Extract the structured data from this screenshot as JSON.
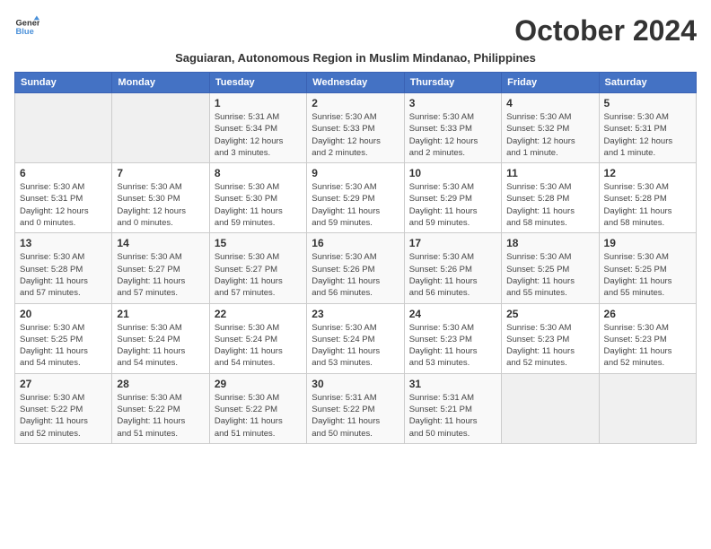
{
  "logo": {
    "line1": "General",
    "line2": "Blue"
  },
  "title": "October 2024",
  "subtitle": "Saguiaran, Autonomous Region in Muslim Mindanao, Philippines",
  "days_header": [
    "Sunday",
    "Monday",
    "Tuesday",
    "Wednesday",
    "Thursday",
    "Friday",
    "Saturday"
  ],
  "weeks": [
    [
      {
        "day": "",
        "info": ""
      },
      {
        "day": "",
        "info": ""
      },
      {
        "day": "1",
        "info": "Sunrise: 5:31 AM\nSunset: 5:34 PM\nDaylight: 12 hours\nand 3 minutes."
      },
      {
        "day": "2",
        "info": "Sunrise: 5:30 AM\nSunset: 5:33 PM\nDaylight: 12 hours\nand 2 minutes."
      },
      {
        "day": "3",
        "info": "Sunrise: 5:30 AM\nSunset: 5:33 PM\nDaylight: 12 hours\nand 2 minutes."
      },
      {
        "day": "4",
        "info": "Sunrise: 5:30 AM\nSunset: 5:32 PM\nDaylight: 12 hours\nand 1 minute."
      },
      {
        "day": "5",
        "info": "Sunrise: 5:30 AM\nSunset: 5:31 PM\nDaylight: 12 hours\nand 1 minute."
      }
    ],
    [
      {
        "day": "6",
        "info": "Sunrise: 5:30 AM\nSunset: 5:31 PM\nDaylight: 12 hours\nand 0 minutes."
      },
      {
        "day": "7",
        "info": "Sunrise: 5:30 AM\nSunset: 5:30 PM\nDaylight: 12 hours\nand 0 minutes."
      },
      {
        "day": "8",
        "info": "Sunrise: 5:30 AM\nSunset: 5:30 PM\nDaylight: 11 hours\nand 59 minutes."
      },
      {
        "day": "9",
        "info": "Sunrise: 5:30 AM\nSunset: 5:29 PM\nDaylight: 11 hours\nand 59 minutes."
      },
      {
        "day": "10",
        "info": "Sunrise: 5:30 AM\nSunset: 5:29 PM\nDaylight: 11 hours\nand 59 minutes."
      },
      {
        "day": "11",
        "info": "Sunrise: 5:30 AM\nSunset: 5:28 PM\nDaylight: 11 hours\nand 58 minutes."
      },
      {
        "day": "12",
        "info": "Sunrise: 5:30 AM\nSunset: 5:28 PM\nDaylight: 11 hours\nand 58 minutes."
      }
    ],
    [
      {
        "day": "13",
        "info": "Sunrise: 5:30 AM\nSunset: 5:28 PM\nDaylight: 11 hours\nand 57 minutes."
      },
      {
        "day": "14",
        "info": "Sunrise: 5:30 AM\nSunset: 5:27 PM\nDaylight: 11 hours\nand 57 minutes."
      },
      {
        "day": "15",
        "info": "Sunrise: 5:30 AM\nSunset: 5:27 PM\nDaylight: 11 hours\nand 57 minutes."
      },
      {
        "day": "16",
        "info": "Sunrise: 5:30 AM\nSunset: 5:26 PM\nDaylight: 11 hours\nand 56 minutes."
      },
      {
        "day": "17",
        "info": "Sunrise: 5:30 AM\nSunset: 5:26 PM\nDaylight: 11 hours\nand 56 minutes."
      },
      {
        "day": "18",
        "info": "Sunrise: 5:30 AM\nSunset: 5:25 PM\nDaylight: 11 hours\nand 55 minutes."
      },
      {
        "day": "19",
        "info": "Sunrise: 5:30 AM\nSunset: 5:25 PM\nDaylight: 11 hours\nand 55 minutes."
      }
    ],
    [
      {
        "day": "20",
        "info": "Sunrise: 5:30 AM\nSunset: 5:25 PM\nDaylight: 11 hours\nand 54 minutes."
      },
      {
        "day": "21",
        "info": "Sunrise: 5:30 AM\nSunset: 5:24 PM\nDaylight: 11 hours\nand 54 minutes."
      },
      {
        "day": "22",
        "info": "Sunrise: 5:30 AM\nSunset: 5:24 PM\nDaylight: 11 hours\nand 54 minutes."
      },
      {
        "day": "23",
        "info": "Sunrise: 5:30 AM\nSunset: 5:24 PM\nDaylight: 11 hours\nand 53 minutes."
      },
      {
        "day": "24",
        "info": "Sunrise: 5:30 AM\nSunset: 5:23 PM\nDaylight: 11 hours\nand 53 minutes."
      },
      {
        "day": "25",
        "info": "Sunrise: 5:30 AM\nSunset: 5:23 PM\nDaylight: 11 hours\nand 52 minutes."
      },
      {
        "day": "26",
        "info": "Sunrise: 5:30 AM\nSunset: 5:23 PM\nDaylight: 11 hours\nand 52 minutes."
      }
    ],
    [
      {
        "day": "27",
        "info": "Sunrise: 5:30 AM\nSunset: 5:22 PM\nDaylight: 11 hours\nand 52 minutes."
      },
      {
        "day": "28",
        "info": "Sunrise: 5:30 AM\nSunset: 5:22 PM\nDaylight: 11 hours\nand 51 minutes."
      },
      {
        "day": "29",
        "info": "Sunrise: 5:30 AM\nSunset: 5:22 PM\nDaylight: 11 hours\nand 51 minutes."
      },
      {
        "day": "30",
        "info": "Sunrise: 5:31 AM\nSunset: 5:22 PM\nDaylight: 11 hours\nand 50 minutes."
      },
      {
        "day": "31",
        "info": "Sunrise: 5:31 AM\nSunset: 5:21 PM\nDaylight: 11 hours\nand 50 minutes."
      },
      {
        "day": "",
        "info": ""
      },
      {
        "day": "",
        "info": ""
      }
    ]
  ]
}
